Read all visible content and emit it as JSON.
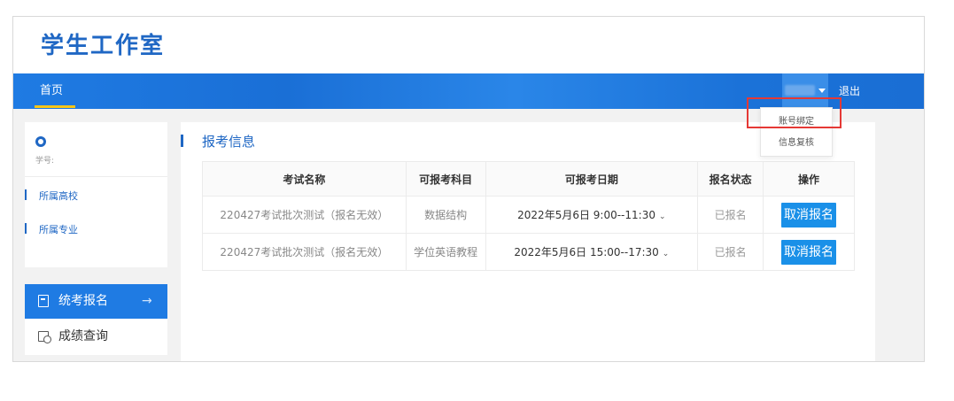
{
  "header": {
    "site_title": "学生工作室"
  },
  "navbar": {
    "home_label": "首页",
    "logout_label": "退出"
  },
  "user_menu": {
    "items": [
      "账号绑定",
      "信息复核"
    ]
  },
  "student_card": {
    "student_id_label": "学号:",
    "school_label": "所属高校",
    "major_label": "所属专业"
  },
  "side_menu": {
    "exam_signup": "统考报名",
    "exam_signup_arrow": "→",
    "score_query": "成绩查询"
  },
  "content": {
    "section_title": "报考信息",
    "table": {
      "headers": [
        "考试名称",
        "可报考科目",
        "可报考日期",
        "报名状态",
        "操作"
      ],
      "rows": [
        {
          "name": "220427考试批次测试（报名无效）",
          "subject": "数据结构",
          "date": "2022年5月6日 9:00--11:30",
          "status": "已报名",
          "action": "取消报名"
        },
        {
          "name": "220427考试批次测试（报名无效）",
          "subject": "学位英语教程",
          "date": "2022年5月6日 15:00--17:30",
          "status": "已报名",
          "action": "取消报名"
        }
      ]
    }
  },
  "colors": {
    "brand": "#1f67c4",
    "nav_bg": "#1f7be3",
    "button_bg": "#1a90e8",
    "highlight": "#e53935",
    "nav_underline": "#f5c518"
  },
  "icons": {
    "avatar": "user-avatar-icon",
    "caret": "chevron-down-icon",
    "exam": "clipboard-icon",
    "score": "search-doc-icon"
  }
}
